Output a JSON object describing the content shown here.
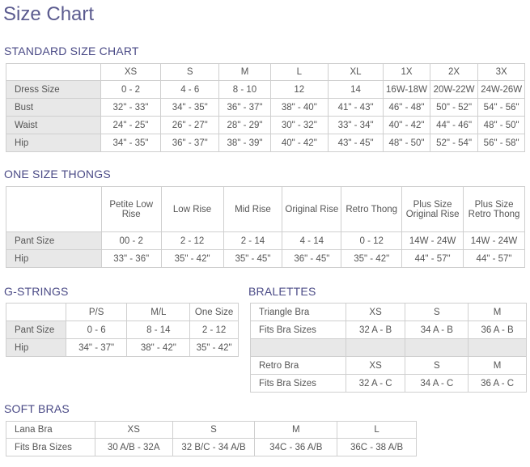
{
  "title": "Size Chart",
  "standard": {
    "heading": "STANDARD SIZE CHART",
    "columns": [
      "XS",
      "S",
      "M",
      "L",
      "XL",
      "1X",
      "2X",
      "3X"
    ],
    "rows": [
      {
        "label": "Dress Size",
        "values": [
          "0 - 2",
          "4 - 6",
          "8 - 10",
          "12",
          "14",
          "16W-18W",
          "20W-22W",
          "24W-26W"
        ]
      },
      {
        "label": "Bust",
        "values": [
          "32\" - 33\"",
          "34\" - 35\"",
          "36\" - 37\"",
          "38\" - 40\"",
          "41\" - 43\"",
          "46\" - 48\"",
          "50\" - 52\"",
          "54\" - 56\""
        ]
      },
      {
        "label": "Waist",
        "values": [
          "24\" - 25\"",
          "26\" - 27\"",
          "28\" - 29\"",
          "30\" - 32\"",
          "33\" - 34\"",
          "40\" - 42\"",
          "44\" - 46\"",
          "48\" - 50\""
        ]
      },
      {
        "label": "Hip",
        "values": [
          "34\" - 35\"",
          "36\" - 37\"",
          "38\" - 39\"",
          "40\" - 42\"",
          "43\" - 45\"",
          "48\" - 50\"",
          "52\" - 54\"",
          "56\" - 58\""
        ]
      }
    ]
  },
  "thongs": {
    "heading": "ONE SIZE THONGS",
    "columns": [
      "Petite Low Rise",
      "Low Rise",
      "Mid Rise",
      "Original Rise",
      "Retro Thong",
      "Plus Size Original Rise",
      "Plus Size Retro Thong"
    ],
    "rows": [
      {
        "label": "Pant Size",
        "values": [
          "00 - 2",
          "2 - 12",
          "2 - 14",
          "4 - 14",
          "0 - 12",
          "14W - 24W",
          "14W - 24W"
        ]
      },
      {
        "label": "Hip",
        "values": [
          "33\" - 36\"",
          "35\" - 42\"",
          "35\" - 45\"",
          "36\" - 45\"",
          "35\" - 42\"",
          "44\" - 57\"",
          "44\" - 57\""
        ]
      }
    ]
  },
  "gstrings": {
    "heading": "G-STRINGS",
    "columns": [
      "P/S",
      "M/L",
      "One Size"
    ],
    "rows": [
      {
        "label": "Pant Size",
        "values": [
          "0 - 6",
          "8 - 14",
          "2 - 12"
        ]
      },
      {
        "label": "Hip",
        "values": [
          "34\" - 37\"",
          "38\" - 42\"",
          "35\" - 42\""
        ]
      }
    ]
  },
  "bralettes": {
    "heading": "BRALETTES",
    "triangle": {
      "label": "Triangle Bra",
      "columns": [
        "XS",
        "S",
        "M"
      ],
      "row_label": "Fits Bra Sizes",
      "values": [
        "32 A - B",
        "34 A - B",
        "36 A - B"
      ]
    },
    "retro": {
      "label": "Retro Bra",
      "columns": [
        "XS",
        "S",
        "M"
      ],
      "row_label": "Fits Bra Sizes",
      "values": [
        "32 A - C",
        "34 A - C",
        "36 A - C"
      ]
    }
  },
  "softbras": {
    "heading": "SOFT BRAS",
    "label": "Lana Bra",
    "columns": [
      "XS",
      "S",
      "M",
      "L"
    ],
    "row_label": "Fits Bra Sizes",
    "values": [
      "30 A/B - 32A",
      "32 B/C - 34 A/B",
      "34C - 36 A/B",
      "36C - 38 A/B"
    ]
  }
}
